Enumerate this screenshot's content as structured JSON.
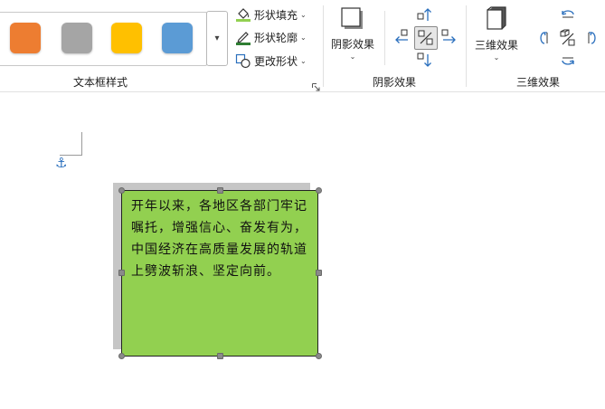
{
  "ribbon": {
    "styles_group": {
      "label": "文本框样式",
      "swatches": [
        {
          "name": "orange",
          "color": "#ed7d31"
        },
        {
          "name": "gray",
          "color": "#a5a5a5"
        },
        {
          "name": "gold",
          "color": "#ffc000"
        },
        {
          "name": "blue",
          "color": "#5b9bd5"
        }
      ],
      "more_icon": "chevron-down-icon"
    },
    "shape_commands": [
      {
        "label": "形状填充",
        "icon": "fill-bucket-icon",
        "accent": "#92d050"
      },
      {
        "label": "形状轮廓",
        "icon": "pen-outline-icon",
        "accent": "#2e7d32"
      },
      {
        "label": "更改形状",
        "icon": "change-shape-icon",
        "accent": "#2a6fbd"
      }
    ],
    "shadow_group": {
      "label": "阴影效果",
      "button_label": "阴影效果"
    },
    "threed_group": {
      "label": "三维效果",
      "button_label": "三维效果"
    }
  },
  "document": {
    "textbox": {
      "text": "开年以来，各地区各部门牢记嘱托，增强信心、奋发有为，中国经济在高质量发展的轨道上劈波斩浪、坚定向前。",
      "fill_color": "#92d050",
      "shadow_color": "#c6c6c6"
    }
  }
}
